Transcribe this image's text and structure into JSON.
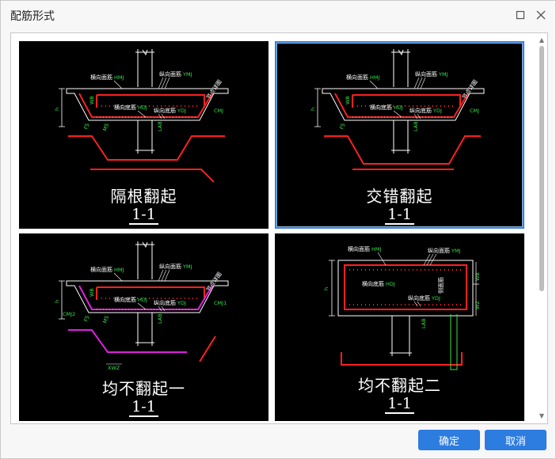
{
  "window": {
    "title": "配筋形式",
    "maximize_icon": "maximize-icon",
    "close_icon": "close-icon"
  },
  "options": [
    {
      "id": "geli",
      "caption": "隔根翻起",
      "section": "1-1",
      "selected": false,
      "labels": {
        "top_trans": "横向面筋",
        "top_trans_code": "HMJ",
        "top_long": "纵向面筋",
        "top_long_code": "YMJ",
        "bot_trans": "横向底筋",
        "bot_trans_code": "HDJ",
        "bot_long": "纵向底筋",
        "bot_long_code": "YDJ",
        "side": "CMJ",
        "side2": "",
        "anchor": "节点详图",
        "h": "h",
        "wb": "WB",
        "lab": "LAB",
        "fs": "FS",
        "ms": "MS",
        "extra": ""
      }
    },
    {
      "id": "jiaocuo",
      "caption": "交错翻起",
      "section": "1-1",
      "selected": true,
      "labels": {
        "top_trans": "横向面筋",
        "top_trans_code": "HMJ",
        "top_long": "纵向面筋",
        "top_long_code": "YMJ",
        "bot_trans": "横向底筋",
        "bot_trans_code": "HDJ",
        "bot_long": "纵向底筋",
        "bot_long_code": "YDJ",
        "side": "CMJ",
        "side2": "",
        "anchor": "节点详图",
        "h": "h",
        "wb": "WB",
        "lab": "LAB",
        "fs": "FS",
        "ms": "",
        "extra": ""
      }
    },
    {
      "id": "junbu1",
      "caption": "均不翻起一",
      "section": "1-1",
      "selected": false,
      "labels": {
        "top_trans": "横向面筋",
        "top_trans_code": "HMJ",
        "top_long": "纵向面筋",
        "top_long_code": "YMJ",
        "bot_trans": "横向底筋",
        "bot_trans_code": "HDJ",
        "bot_long": "纵向底筋",
        "bot_long_code": "YDJ",
        "side": "CMJ1",
        "side2": "CMJ2",
        "anchor": "节点详图",
        "h": "h",
        "wb": "WB",
        "lab": "LAB",
        "fs": "FS",
        "ms": "MS",
        "extra": "XWZ"
      }
    },
    {
      "id": "junbu2",
      "caption": "均不翻起二",
      "section": "1-1",
      "selected": false,
      "labels": {
        "top_trans": "横向面筋",
        "top_trans_code": "HMJ",
        "top_long": "纵向面筋",
        "top_long_code": "YMJ",
        "bot_trans": "横向底筋",
        "bot_trans_code": "HDJ",
        "bot_long": "纵向底筋",
        "bot_long_code": "YDJ",
        "side": "侧面筋",
        "side2": "",
        "anchor": "",
        "h": "h",
        "wb": "WB",
        "lab": "LAB",
        "fs": "FS",
        "ms": "",
        "extra": "WZ"
      }
    }
  ],
  "buttons": {
    "ok": "确定",
    "cancel": "取消"
  },
  "colors": {
    "accent": "#2d7ce0",
    "rebar": "#ff2020",
    "label_green": "#37e04a",
    "magenta": "#e020e0",
    "canvas": "#000000"
  }
}
